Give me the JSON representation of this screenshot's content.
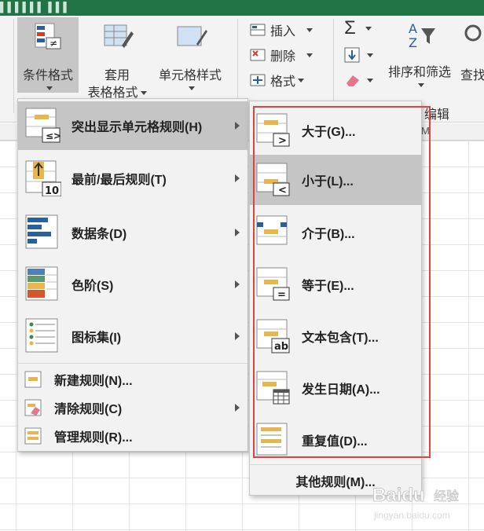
{
  "ribbon": {
    "cond_format": "条件格式",
    "format_table_1": "套用",
    "format_table_2": "表格格式",
    "cell_styles": "单元格样式",
    "insert": "插入",
    "delete": "删除",
    "format": "格式",
    "sigma": "Σ",
    "sort_filter": "排序和筛选",
    "find": "查找",
    "edit_group": "编辑"
  },
  "sheet": {
    "col_m": "M"
  },
  "menu": {
    "items": [
      {
        "label": "突出显示单元格规则(H)",
        "icon": "highlight-cells-icon"
      },
      {
        "label": "最前/最后规则(T)",
        "icon": "top-bottom-icon",
        "badge": "10"
      },
      {
        "label": "数据条(D)",
        "icon": "data-bars-icon"
      },
      {
        "label": "色阶(S)",
        "icon": "color-scales-icon"
      },
      {
        "label": "图标集(I)",
        "icon": "icon-sets-icon"
      }
    ],
    "small_items": [
      {
        "label": "新建规则(N)..."
      },
      {
        "label": "清除规则(C)"
      },
      {
        "label": "管理规则(R)..."
      }
    ]
  },
  "submenu": {
    "items": [
      {
        "label": "大于(G)...",
        "glyph": ">"
      },
      {
        "label": "小于(L)...",
        "glyph": "<"
      },
      {
        "label": "介于(B)...",
        "glyph": ""
      },
      {
        "label": "等于(E)...",
        "glyph": "="
      },
      {
        "label": "文本包含(T)...",
        "glyph": "ab"
      },
      {
        "label": "发生日期(A)...",
        "glyph": ""
      },
      {
        "label": "重复值(D)...",
        "glyph": ""
      }
    ],
    "more": "其他规则(M)..."
  },
  "watermark": {
    "brand": "Baidu",
    "cn": "经验",
    "url": "jingyan.baidu.com"
  },
  "colors": {
    "accent_orange": "#e8b64e",
    "accent_blue": "#2a5f9e",
    "highlight": "#c5c5c5",
    "callout": "#e2423f"
  }
}
